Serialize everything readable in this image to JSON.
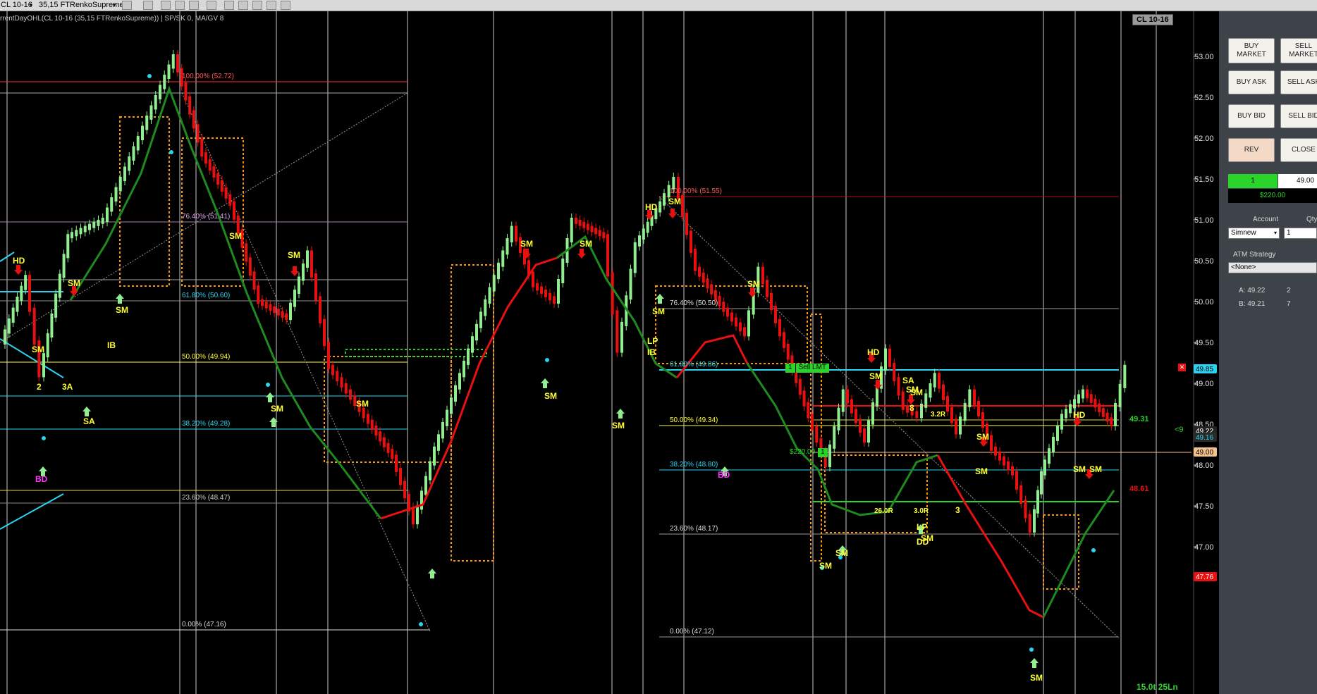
{
  "toolbar": {
    "instrument": "CL 10-16",
    "bar_type": "35,15 FTRenkoSupreme",
    "indicator_caption": "rrentDayOHL(CL 10-16 (35,15 FTRenkoSupreme)) | SP/SK 0, MA/GV 8"
  },
  "chart": {
    "instrument_badge": "CL 10-16",
    "footer": "15.0t 25Ln",
    "colors": {
      "background": "#000000",
      "up_bar": "#90ee90",
      "down_bar": "#e81010",
      "ma_up": "#1f8a1f",
      "ma_down": "#e81010",
      "cyan": "#2ad4f0",
      "orange": "#ff9900",
      "yellow": "#ffff33"
    },
    "price_axis": {
      "ticks": [
        "53.00",
        "52.50",
        "52.00",
        "51.50",
        "51.00",
        "50.50",
        "50.00",
        "49.50",
        "49.00",
        "48.50",
        "48.00",
        "47.50",
        "47.00"
      ],
      "tags": [
        {
          "text": "49.85",
          "bg": "#2ad4f0",
          "fg": "#000"
        },
        {
          "text": "49.22",
          "bg": "#222",
          "fg": "#fff"
        },
        {
          "text": "49.16",
          "bg": "#2a2a2a",
          "fg": "#2ad4f0"
        },
        {
          "text": "49.00",
          "bg": "#f2c18d",
          "fg": "#000"
        },
        {
          "text": "47.76",
          "bg": "#e81010",
          "fg": "#fff"
        }
      ]
    },
    "fib_set1": [
      {
        "text": "100.00% (52.72)",
        "color": "#ff5555"
      },
      {
        "text": "76.40% (51.41)",
        "color": "#e0a0e8"
      },
      {
        "text": "61.80% (50.60)",
        "color": "#2ad4f0"
      },
      {
        "text": "50.00% (49.94)",
        "color": "#ffff33"
      },
      {
        "text": "38.20% (49.28)",
        "color": "#2ad4f0"
      },
      {
        "text": "23.60% (48.47)",
        "color": "#cccccc"
      },
      {
        "text": "0.00% (47.16)",
        "color": "#dddddd"
      }
    ],
    "fib_set2": [
      {
        "text": "100.00% (51.55)",
        "color": "#ff5555"
      },
      {
        "text": "76.40% (50.50)",
        "color": "#dddddd"
      },
      {
        "text": "61.80% (49.86)",
        "color": "#2ad4f0"
      },
      {
        "text": "50.00% (49.34)",
        "color": "#ffff33"
      },
      {
        "text": "38.20% (48.80)",
        "color": "#2ad4f0"
      },
      {
        "text": "23.60% (48.17)",
        "color": "#dddddd"
      },
      {
        "text": "0.00% (47.12)",
        "color": "#dddddd"
      }
    ],
    "order_tags": {
      "sell_lmt_qty": "1",
      "sell_lmt_label": "Sell LMT",
      "position_pnl": "$220.00",
      "position_qty": "1",
      "right_49_31": "49.31",
      "right_48_61": "48.61",
      "arrow_label": "<9"
    },
    "signals": [
      {
        "text": "HD",
        "color": "#ffff33"
      },
      {
        "text": "SM",
        "color": "#ffff33"
      },
      {
        "text": "SA",
        "color": "#ffff33"
      },
      {
        "text": "IB",
        "color": "#ffff33"
      },
      {
        "text": "LP",
        "color": "#ffff33"
      },
      {
        "text": "BD",
        "color": "#ff33ff"
      },
      {
        "text": "DD",
        "color": "#ffff33"
      },
      {
        "text": "2",
        "color": "#ffff33"
      },
      {
        "text": "3",
        "color": "#ffff33"
      },
      {
        "text": "8",
        "color": "#ffff33"
      },
      {
        "text": "3A",
        "color": "#ffff33"
      },
      {
        "text": "26.0R",
        "color": "#ffff33"
      },
      {
        "text": "3.0R",
        "color": "#ffff33"
      },
      {
        "text": "3.2R",
        "color": "#ffff33"
      }
    ]
  },
  "order_panel": {
    "buy_market": "BUY MARKET",
    "sell_market": "SELL MARKET",
    "buy_ask": "BUY ASK",
    "sell_ask": "SELL ASK",
    "buy_bid": "BUY BID",
    "sell_bid": "SELL BID",
    "rev": "REV",
    "close": "CLOSE",
    "position_qty": "1",
    "position_price": "49.00",
    "position_pnl": "$220.00",
    "account_label": "Account",
    "qty_label": "Qty",
    "account_value": "Simnew",
    "qty_value": "1",
    "atm_label": "ATM Strategy",
    "atm_value": "<None>",
    "ask_label": "A: 49.22",
    "ask_size": "2",
    "bid_label": "B: 49.21",
    "bid_size": "7"
  }
}
